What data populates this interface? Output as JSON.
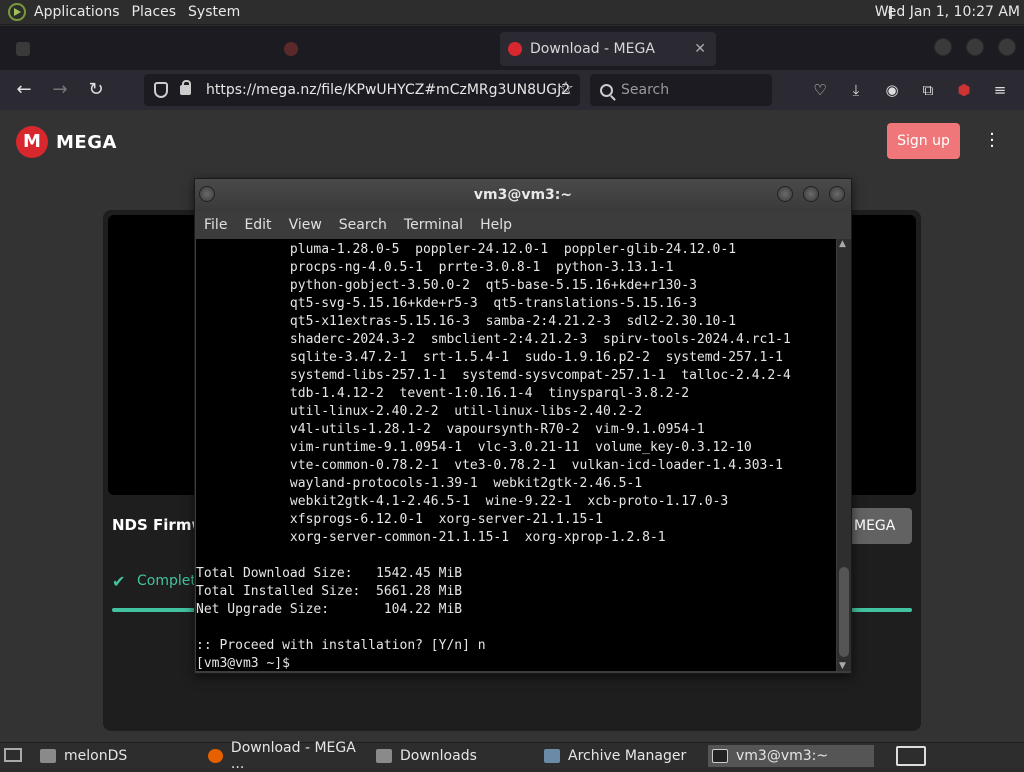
{
  "topbar": {
    "menus": [
      "Applications",
      "Places",
      "System"
    ],
    "clock": "Wed Jan  1, 10:27 AM"
  },
  "browser": {
    "tabs": [
      {
        "label": "",
        "icon": "trash-icon",
        "active": false
      },
      {
        "label": "",
        "icon": "circle-icon",
        "active": false
      },
      {
        "label": "Download - MEGA",
        "icon": "mega-icon",
        "active": true
      }
    ],
    "url": "https://mega.nz/file/KPwUHYCZ#mCzMRg3UN8UGJ2",
    "search_placeholder": "Search"
  },
  "mega": {
    "logo_letter": "M",
    "logo_text": "MEGA",
    "signup": "Sign up",
    "file_name": "NDS Firmw",
    "download_btn": "MEGA",
    "status": "Complete",
    "progress_percent": 100,
    "accent": "#d9272e",
    "complete_color": "#42c3a0"
  },
  "terminal": {
    "title": "vm3@vm3:~",
    "menu": [
      "File",
      "Edit",
      "View",
      "Search",
      "Terminal",
      "Help"
    ],
    "lines": [
      "            pluma-1.28.0-5  poppler-24.12.0-1  poppler-glib-24.12.0-1",
      "            procps-ng-4.0.5-1  prrte-3.0.8-1  python-3.13.1-1",
      "            python-gobject-3.50.0-2  qt5-base-5.15.16+kde+r130-3",
      "            qt5-svg-5.15.16+kde+r5-3  qt5-translations-5.15.16-3",
      "            qt5-x11extras-5.15.16-3  samba-2:4.21.2-3  sdl2-2.30.10-1",
      "            shaderc-2024.3-2  smbclient-2:4.21.2-3  spirv-tools-2024.4.rc1-1",
      "            sqlite-3.47.2-1  srt-1.5.4-1  sudo-1.9.16.p2-2  systemd-257.1-1",
      "            systemd-libs-257.1-1  systemd-sysvcompat-257.1-1  talloc-2.4.2-4",
      "            tdb-1.4.12-2  tevent-1:0.16.1-4  tinysparql-3.8.2-2",
      "            util-linux-2.40.2-2  util-linux-libs-2.40.2-2",
      "            v4l-utils-1.28.1-2  vapoursynth-R70-2  vim-9.1.0954-1",
      "            vim-runtime-9.1.0954-1  vlc-3.0.21-11  volume_key-0.3.12-10",
      "            vte-common-0.78.2-1  vte3-0.78.2-1  vulkan-icd-loader-1.4.303-1",
      "            wayland-protocols-1.39-1  webkit2gtk-2.46.5-1",
      "            webkit2gtk-4.1-2.46.5-1  wine-9.22-1  xcb-proto-1.17.0-3",
      "            xfsprogs-6.12.0-1  xorg-server-21.1.15-1",
      "            xorg-server-common-21.1.15-1  xorg-xprop-1.2.8-1",
      "",
      "Total Download Size:   1542.45 MiB",
      "Total Installed Size:  5661.28 MiB",
      "Net Upgrade Size:       104.22 MiB",
      "",
      ":: Proceed with installation? [Y/n] n",
      "[vm3@vm3 ~]$ "
    ]
  },
  "taskbar": {
    "tasks": [
      {
        "label": "melonDS",
        "icon": "folder-icon",
        "active": false
      },
      {
        "label": "Download - MEGA ...",
        "icon": "firefox-icon",
        "active": false
      },
      {
        "label": "Downloads",
        "icon": "folder-icon",
        "active": false
      },
      {
        "label": "Archive Manager",
        "icon": "archive-icon",
        "active": false
      },
      {
        "label": "vm3@vm3:~",
        "icon": "terminal-icon",
        "active": true
      }
    ]
  }
}
